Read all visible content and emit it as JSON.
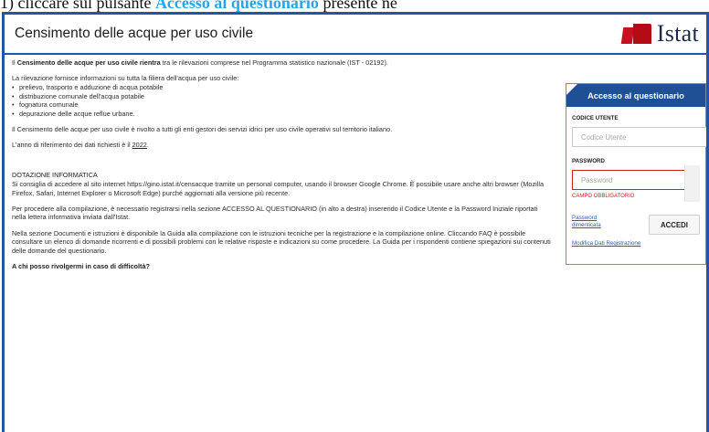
{
  "caption": {
    "prefix": "1) cliccare sul pulsante ",
    "highlight": "Accesso al questionario",
    "suffix": " presente ne"
  },
  "header": {
    "title": "Censimento delle acque per uso civile",
    "logo_text": "Istat",
    "logo_colors": [
      "#c8101e",
      "#b30c17"
    ]
  },
  "intro": {
    "pre": "Il ",
    "bold": "Censimento delle acque per uso civile rientra",
    "post": " tra le rilevazioni comprese nel Programma statistico nazionale (IST - 02192)."
  },
  "filiera": {
    "lead": "La rilevazione fornisce informazioni su tutta la filiera dell'acqua per uso civile:",
    "items": [
      "prelievo, trasporto e adduzione di acqua potabile",
      "distribuzione comunale dell'acqua potabile",
      "fognatura comunale",
      "depurazione delle acque reflue urbane."
    ]
  },
  "rivolto": "Il Censimento delle acque per uso civile è rivolto a tutti gli enti gestori dei servizi idrici per uso civile operativi sul territorio italiano.",
  "anno": {
    "text": "L'anno di riferimento dei dati richiesti è il ",
    "year": "2022",
    "end": "."
  },
  "dotazione": {
    "heading": "DOTAZIONE INFORMATICA",
    "text": "Si consiglia di accedere al sito internet https://gino.istat.it/censacque tramite un personal computer, usando il browser Google Chrome. È possibile usare anche altri browser (Mozilla Firefox, Safari, Internet Explorer o Microsoft Edge) purché aggiornati alla versione più recente."
  },
  "compilazione": "Per procedere alla compilazione, è necessario registrarsi nella sezione ACCESSO AL QUESTIONARIO (in alto a destra) inserendo il Codice Utente e la Password Iniziale riportati nella lettera informativa inviata dall'Istat.",
  "documenti": "Nella sezione Documenti e istruzioni è disponibile la Guida alla compilazione con le istruzioni tecniche per la registrazione e la compilazione online. Cliccando FAQ è possibile consultare un elenco di domande ricorrenti e di possibili problemi con le relative risposte e indicazioni su come procedere. La Guida per i rispondenti contiene spiegazioni sui contenuti delle domande del questionario.",
  "question": "A chi posso rivolgermi in caso di difficoltà?",
  "login": {
    "title": "Accesso al questionario",
    "user_label": "CODICE UTENTE",
    "user_placeholder": "Codice Utente",
    "pw_label": "PASSWORD",
    "pw_placeholder": "Password",
    "error": "CAMPO OBBLIGATORIO",
    "forgot": "Password dimenticata",
    "submit": "ACCEDI",
    "modify": "Modifica Dati Registrazione",
    "header_color": "#1f4f95",
    "error_color": "#d31f1f"
  }
}
